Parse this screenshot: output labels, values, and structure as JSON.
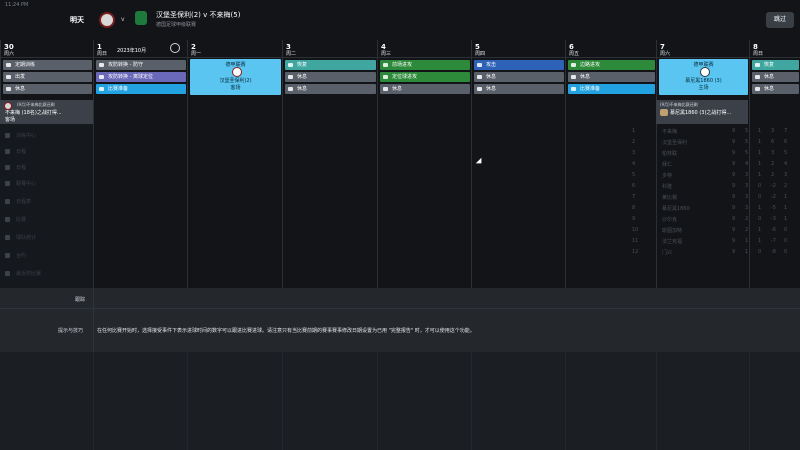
{
  "status_time": "11:24 PM",
  "header": {
    "when": "明天",
    "vs": "v",
    "fixture": "汉堡圣保利(2) v 不来梅(5)",
    "subtitle": "德国足球甲级联赛",
    "skip_label": "跳过"
  },
  "days": [
    {
      "num": "30",
      "dow": "周六"
    },
    {
      "num": "1",
      "dow": "周日"
    },
    {
      "num": "2",
      "dow": "周一"
    },
    {
      "num": "3",
      "dow": "周二"
    },
    {
      "num": "4",
      "dow": "周三"
    },
    {
      "num": "5",
      "dow": "周四"
    },
    {
      "num": "6",
      "dow": "周五"
    },
    {
      "num": "7",
      "dow": "周六"
    },
    {
      "num": "8",
      "dow": "周日"
    }
  ],
  "month_label": "2023年10月",
  "col0": [
    "定期训练",
    "出发",
    "休息"
  ],
  "col1": [
    "攻防转换 - 防守",
    "攻防转换 - 离球定位",
    "比赛准备"
  ],
  "match_card": {
    "title": "德甲联赛",
    "team": "汉堡圣保利(2)",
    "venue": "客场"
  },
  "col3": [
    "恢复",
    "休息",
    "休息"
  ],
  "col4": [
    "前场进攻",
    "定位球进攻",
    "休息"
  ],
  "col5": [
    "攻击",
    "休息",
    "休息"
  ],
  "col6": [
    "边路进攻",
    "休息",
    "比赛准备"
  ],
  "match_card2": {
    "title": "德甲联赛",
    "team": "慕尼黑1860 (3)",
    "venue": "主场"
  },
  "col8": [
    "恢复",
    "休息",
    "休息"
  ],
  "notice": {
    "title": "(9月)不来梅比赛还剩",
    "team": "不来梅 (18名)之战打得...",
    "venue": "客场"
  },
  "notice2": {
    "title": "(9月)不来梅比赛还剩",
    "team": "慕尼黑1860 (3)之战打得..."
  },
  "left_menu": [
    "训练中心",
    "日程",
    "日程",
    "联赛中心",
    "日程表",
    "比赛",
    "球队统计",
    "合约",
    "最近的比赛"
  ],
  "table": [
    {
      "pos": "1",
      "team": "不来梅",
      "a": "9",
      "b": "5",
      "c": "1",
      "d": "3",
      "e": "7"
    },
    {
      "pos": "2",
      "team": "汉堡圣保利",
      "a": "9",
      "b": "5",
      "c": "1",
      "d": "6",
      "e": "6"
    },
    {
      "pos": "3",
      "team": "柏林联",
      "a": "9",
      "b": "5",
      "c": "1",
      "d": "3",
      "e": "5"
    },
    {
      "pos": "4",
      "team": "拜仁",
      "a": "9",
      "b": "4",
      "c": "1",
      "d": "2",
      "e": "4"
    },
    {
      "pos": "5",
      "team": "多特",
      "a": "9",
      "b": "3",
      "c": "1",
      "d": "2",
      "e": "3"
    },
    {
      "pos": "6",
      "team": "科隆",
      "a": "9",
      "b": "3",
      "c": "0",
      "d": "-2",
      "e": "2"
    },
    {
      "pos": "7",
      "team": "莱比锡",
      "a": "9",
      "b": "3",
      "c": "0",
      "d": "-2",
      "e": "1"
    },
    {
      "pos": "8",
      "team": "慕尼黑1860",
      "a": "9",
      "b": "3",
      "c": "1",
      "d": "-5",
      "e": "1"
    },
    {
      "pos": "9",
      "team": "沙尔克",
      "a": "9",
      "b": "2",
      "c": "0",
      "d": "-3",
      "e": "1"
    },
    {
      "pos": "10",
      "team": "斯图加特",
      "a": "9",
      "b": "2",
      "c": "1",
      "d": "-6",
      "e": "0"
    },
    {
      "pos": "11",
      "team": "法兰克福",
      "a": "9",
      "b": "1",
      "c": "1",
      "d": "-7",
      "e": "0"
    },
    {
      "pos": "12",
      "team": "门兴",
      "a": "9",
      "b": "1",
      "c": "0",
      "d": "-8",
      "e": "0"
    }
  ],
  "mid": {
    "label1": "跟踪",
    "label2": "提示与技巧",
    "tip": "在任何比赛开始时，选择接受事件下表示进球时间的数字可以跟进比赛进球。请注意只有当比赛前期的赛事赛事修改日期设置为已用 \"完整报告\" 时，才可以使用这个功能。"
  }
}
